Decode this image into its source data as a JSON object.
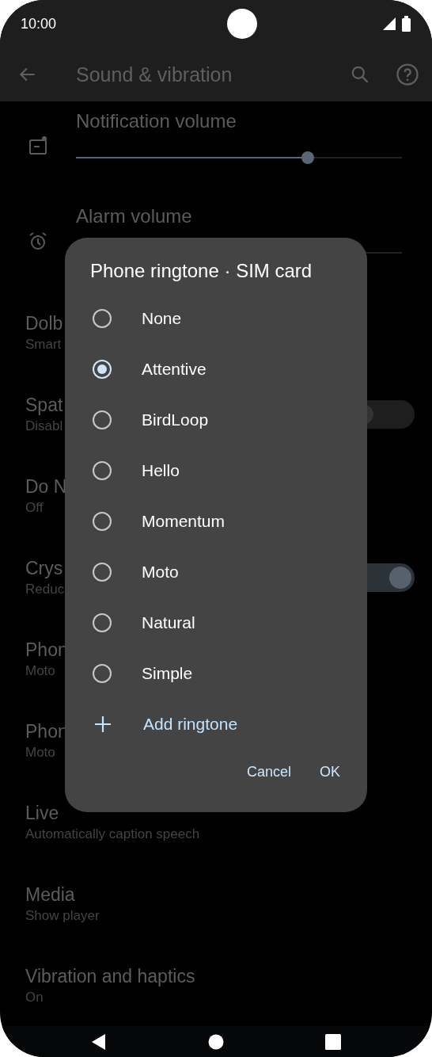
{
  "status_bar": {
    "time": "10:00"
  },
  "app_bar": {
    "title": "Sound & vibration"
  },
  "volumes": [
    {
      "title": "Notification volume",
      "level": 0.71
    },
    {
      "title": "Alarm volume"
    }
  ],
  "settings": [
    {
      "title": "Dolb",
      "subtitle": "Smart",
      "kind": "text"
    },
    {
      "title": "Spat",
      "subtitle": "Disabl",
      "kind": "switch",
      "on": false
    },
    {
      "title": "Do N",
      "subtitle": "Off",
      "kind": "text"
    },
    {
      "title": "Crys",
      "subtitle": "Reduc",
      "kind": "switch",
      "on": true
    },
    {
      "title": "Phon",
      "subtitle": "Moto",
      "kind": "text"
    },
    {
      "title": "Phon",
      "subtitle": "Moto",
      "kind": "text"
    },
    {
      "title": "Live",
      "subtitle": "Automatically caption speech",
      "kind": "text"
    },
    {
      "title": "Media",
      "subtitle": "Show player",
      "kind": "text"
    },
    {
      "title": "Vibration and haptics",
      "subtitle": "On",
      "kind": "text"
    }
  ],
  "dialog": {
    "title": "Phone ringtone · SIM card",
    "options": [
      {
        "label": "None",
        "selected": false
      },
      {
        "label": "Attentive",
        "selected": true
      },
      {
        "label": "BirdLoop",
        "selected": false
      },
      {
        "label": "Hello",
        "selected": false
      },
      {
        "label": "Momentum",
        "selected": false
      },
      {
        "label": "Moto",
        "selected": false
      },
      {
        "label": "Natural",
        "selected": false
      },
      {
        "label": "Simple",
        "selected": false
      }
    ],
    "add_label": "Add ringtone",
    "buttons": [
      "Cancel",
      "OK"
    ]
  }
}
